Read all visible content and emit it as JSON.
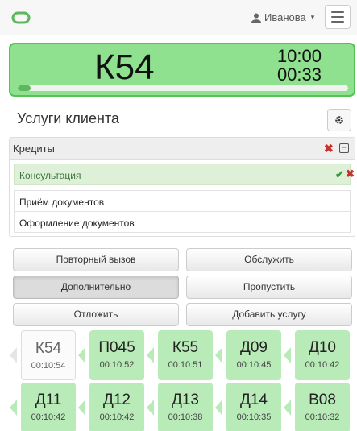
{
  "header": {
    "user_name": "Иванова",
    "user_caret": "▾"
  },
  "ticket": {
    "number": "К54",
    "time_total": "10:00",
    "time_elapsed": "00:33",
    "progress_percent": 4
  },
  "services": {
    "title": "Услуги клиента",
    "group": {
      "name": "Кредиты"
    },
    "items": [
      {
        "label": "Консультация",
        "active": true
      },
      {
        "label": "Приём документов",
        "active": false
      },
      {
        "label": "Оформление документов",
        "active": false
      }
    ]
  },
  "actions": {
    "repeat_call": "Повторный вызов",
    "serve": "Обслужить",
    "additional": "Дополнительно",
    "skip": "Пропустить",
    "postpone": "Отложить",
    "add_service": "Добавить услугу"
  },
  "queue": [
    {
      "code": "К54",
      "time": "00:10:54",
      "style": "white"
    },
    {
      "code": "П045",
      "time": "00:10:52",
      "style": "green"
    },
    {
      "code": "К55",
      "time": "00:10:51",
      "style": "green"
    },
    {
      "code": "Д09",
      "time": "00:10:45",
      "style": "green"
    },
    {
      "code": "Д10",
      "time": "00:10:42",
      "style": "green"
    },
    {
      "code": "Д11",
      "time": "00:10:42",
      "style": "green"
    },
    {
      "code": "Д12",
      "time": "00:10:42",
      "style": "green"
    },
    {
      "code": "Д13",
      "time": "00:10:38",
      "style": "green"
    },
    {
      "code": "Д14",
      "time": "00:10:35",
      "style": "green"
    },
    {
      "code": "В08",
      "time": "00:10:32",
      "style": "green"
    }
  ],
  "colors": {
    "ticket_bg": "#8fe08f",
    "ticket_border": "#56c256",
    "tile_green": "#b9ebb9",
    "accent_green": "#5cb85c",
    "danger": "#c9302c"
  }
}
